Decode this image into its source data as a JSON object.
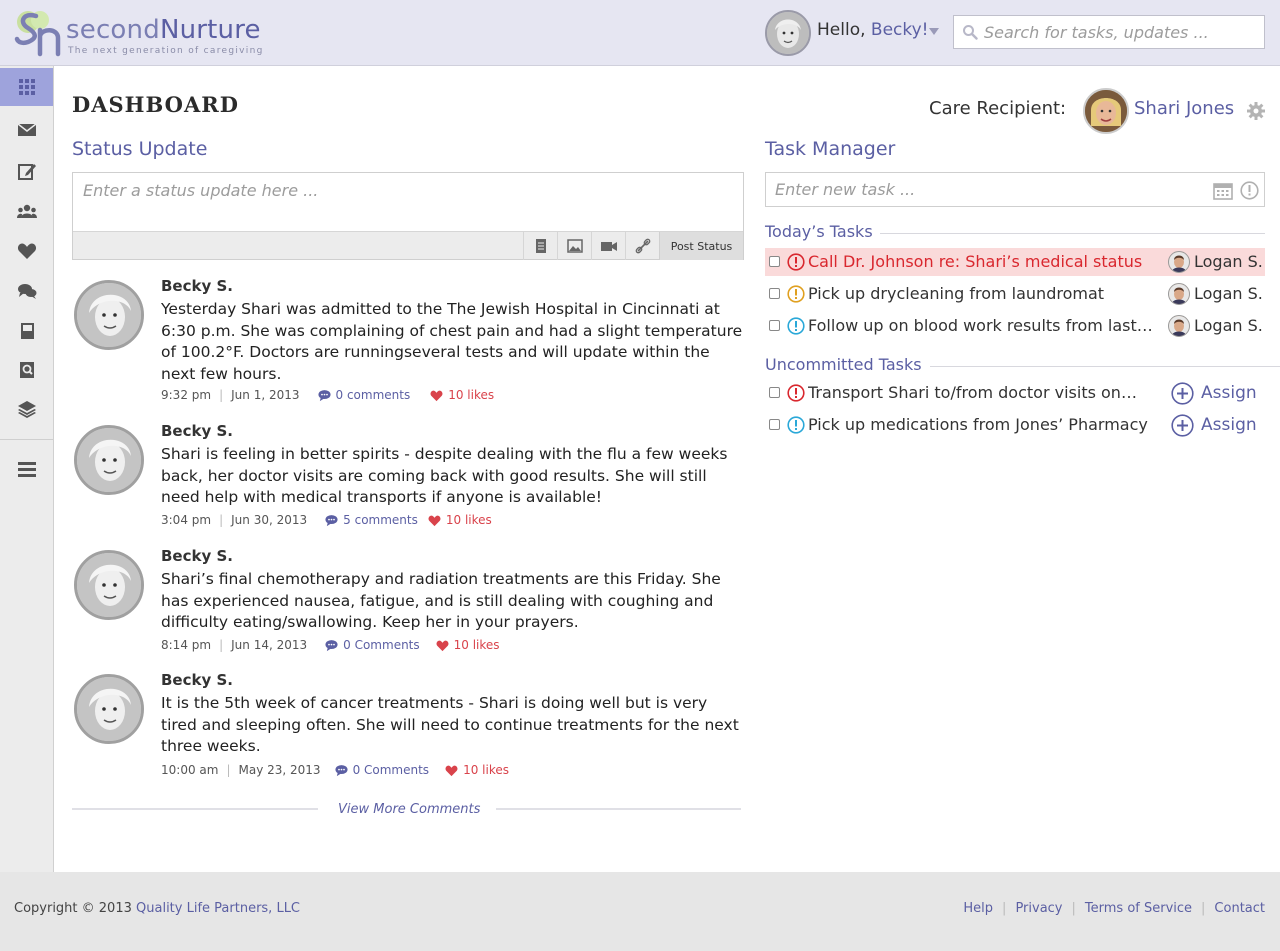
{
  "brand": {
    "name_part1": "second",
    "name_part2": "Nurture",
    "tagline": "The next generation of caregiving"
  },
  "header": {
    "greeting": "Hello,",
    "user_name": "Becky!",
    "search_placeholder": "Search for tasks, updates ..."
  },
  "sidebar": {
    "items": [
      {
        "icon": "grid-icon",
        "active": true
      },
      {
        "icon": "envelope-icon"
      },
      {
        "icon": "edit-icon"
      },
      {
        "icon": "group-icon"
      },
      {
        "icon": "heart-icon"
      },
      {
        "icon": "chat-icon"
      },
      {
        "icon": "book-icon"
      },
      {
        "icon": "search-doc-icon"
      },
      {
        "icon": "layers-icon"
      },
      {
        "icon": "menu-icon"
      }
    ]
  },
  "dashboard": {
    "title": "DASHBOARD",
    "care_recipient_label": "Care Recipient:",
    "care_recipient_name": "Shari Jones"
  },
  "status_update": {
    "title": "Status Update",
    "placeholder": "Enter a status update here ...",
    "post_label": "Post Status"
  },
  "posts": [
    {
      "author": "Becky S.",
      "body": "Yesterday Shari was admitted to the The Jewish Hospital in Cincinnati at 6:30 p.m. She was complaining of chest pain and had a slight temperature of 100.2°F. Doctors are runningseveral tests and will update within the next few hours.",
      "time": "9:32 pm",
      "date": "Jun 1, 2013",
      "comments": "0 comments",
      "likes": "10 likes"
    },
    {
      "author": "Becky S.",
      "body": "Shari is feeling in better spirits - despite dealing with the flu a few weeks back, her doctor visits are coming back with good results. She will still need help with medical transports if anyone is available!",
      "time": "3:04 pm",
      "date": "Jun 30, 2013",
      "comments": "5 comments",
      "likes": "10 likes"
    },
    {
      "author": "Becky S.",
      "body": "Shari’s final chemotherapy and radiation treatments are this Friday. She has experienced nausea, fatigue, and is still dealing with coughing and difficulty eating/swallowing. Keep her in your prayers.",
      "time": "8:14 pm",
      "date": "Jun 14, 2013",
      "comments": "0 Comments",
      "likes": "10 likes"
    },
    {
      "author": "Becky S.",
      "body": "It is the 5th week of cancer treatments - Shari is doing well but is very tired and sleeping often. She will need to continue treatments for the next three weeks.",
      "time": "10:00 am",
      "date": "May 23, 2013",
      "comments": "0 Comments",
      "likes": "10 likes"
    }
  ],
  "view_more": "View More Comments",
  "task_manager": {
    "title": "Task Manager",
    "placeholder": "Enter new task ...",
    "today_label": "Today’s Tasks",
    "uncommitted_label": "Uncommitted Tasks",
    "today": [
      {
        "text": "Call Dr. Johnson re: Shari’s medical status",
        "priority": "high",
        "assignee": "Logan S."
      },
      {
        "text": "Pick up drycleaning from laundromat",
        "priority": "medium",
        "assignee": "Logan S."
      },
      {
        "text": "Follow up on blood work results from last week",
        "priority": "low",
        "assignee": "Logan S."
      }
    ],
    "uncommitted": [
      {
        "text": "Transport Shari to/from doctor visits on Monday",
        "priority": "high",
        "action": "Assign"
      },
      {
        "text": "Pick up medications from Jones’ Pharmacy",
        "priority": "low",
        "action": "Assign"
      }
    ]
  },
  "colors": {
    "accent": "#5b5fa3",
    "high": "#d9272e",
    "medium": "#e0a020",
    "low": "#2aa8d8",
    "like": "#d9434b"
  },
  "footer": {
    "copyright": "Copyright © 2013",
    "company": "Quality Life Partners, LLC",
    "links": [
      "Help",
      "Privacy",
      "Terms of Service",
      "Contact"
    ]
  }
}
